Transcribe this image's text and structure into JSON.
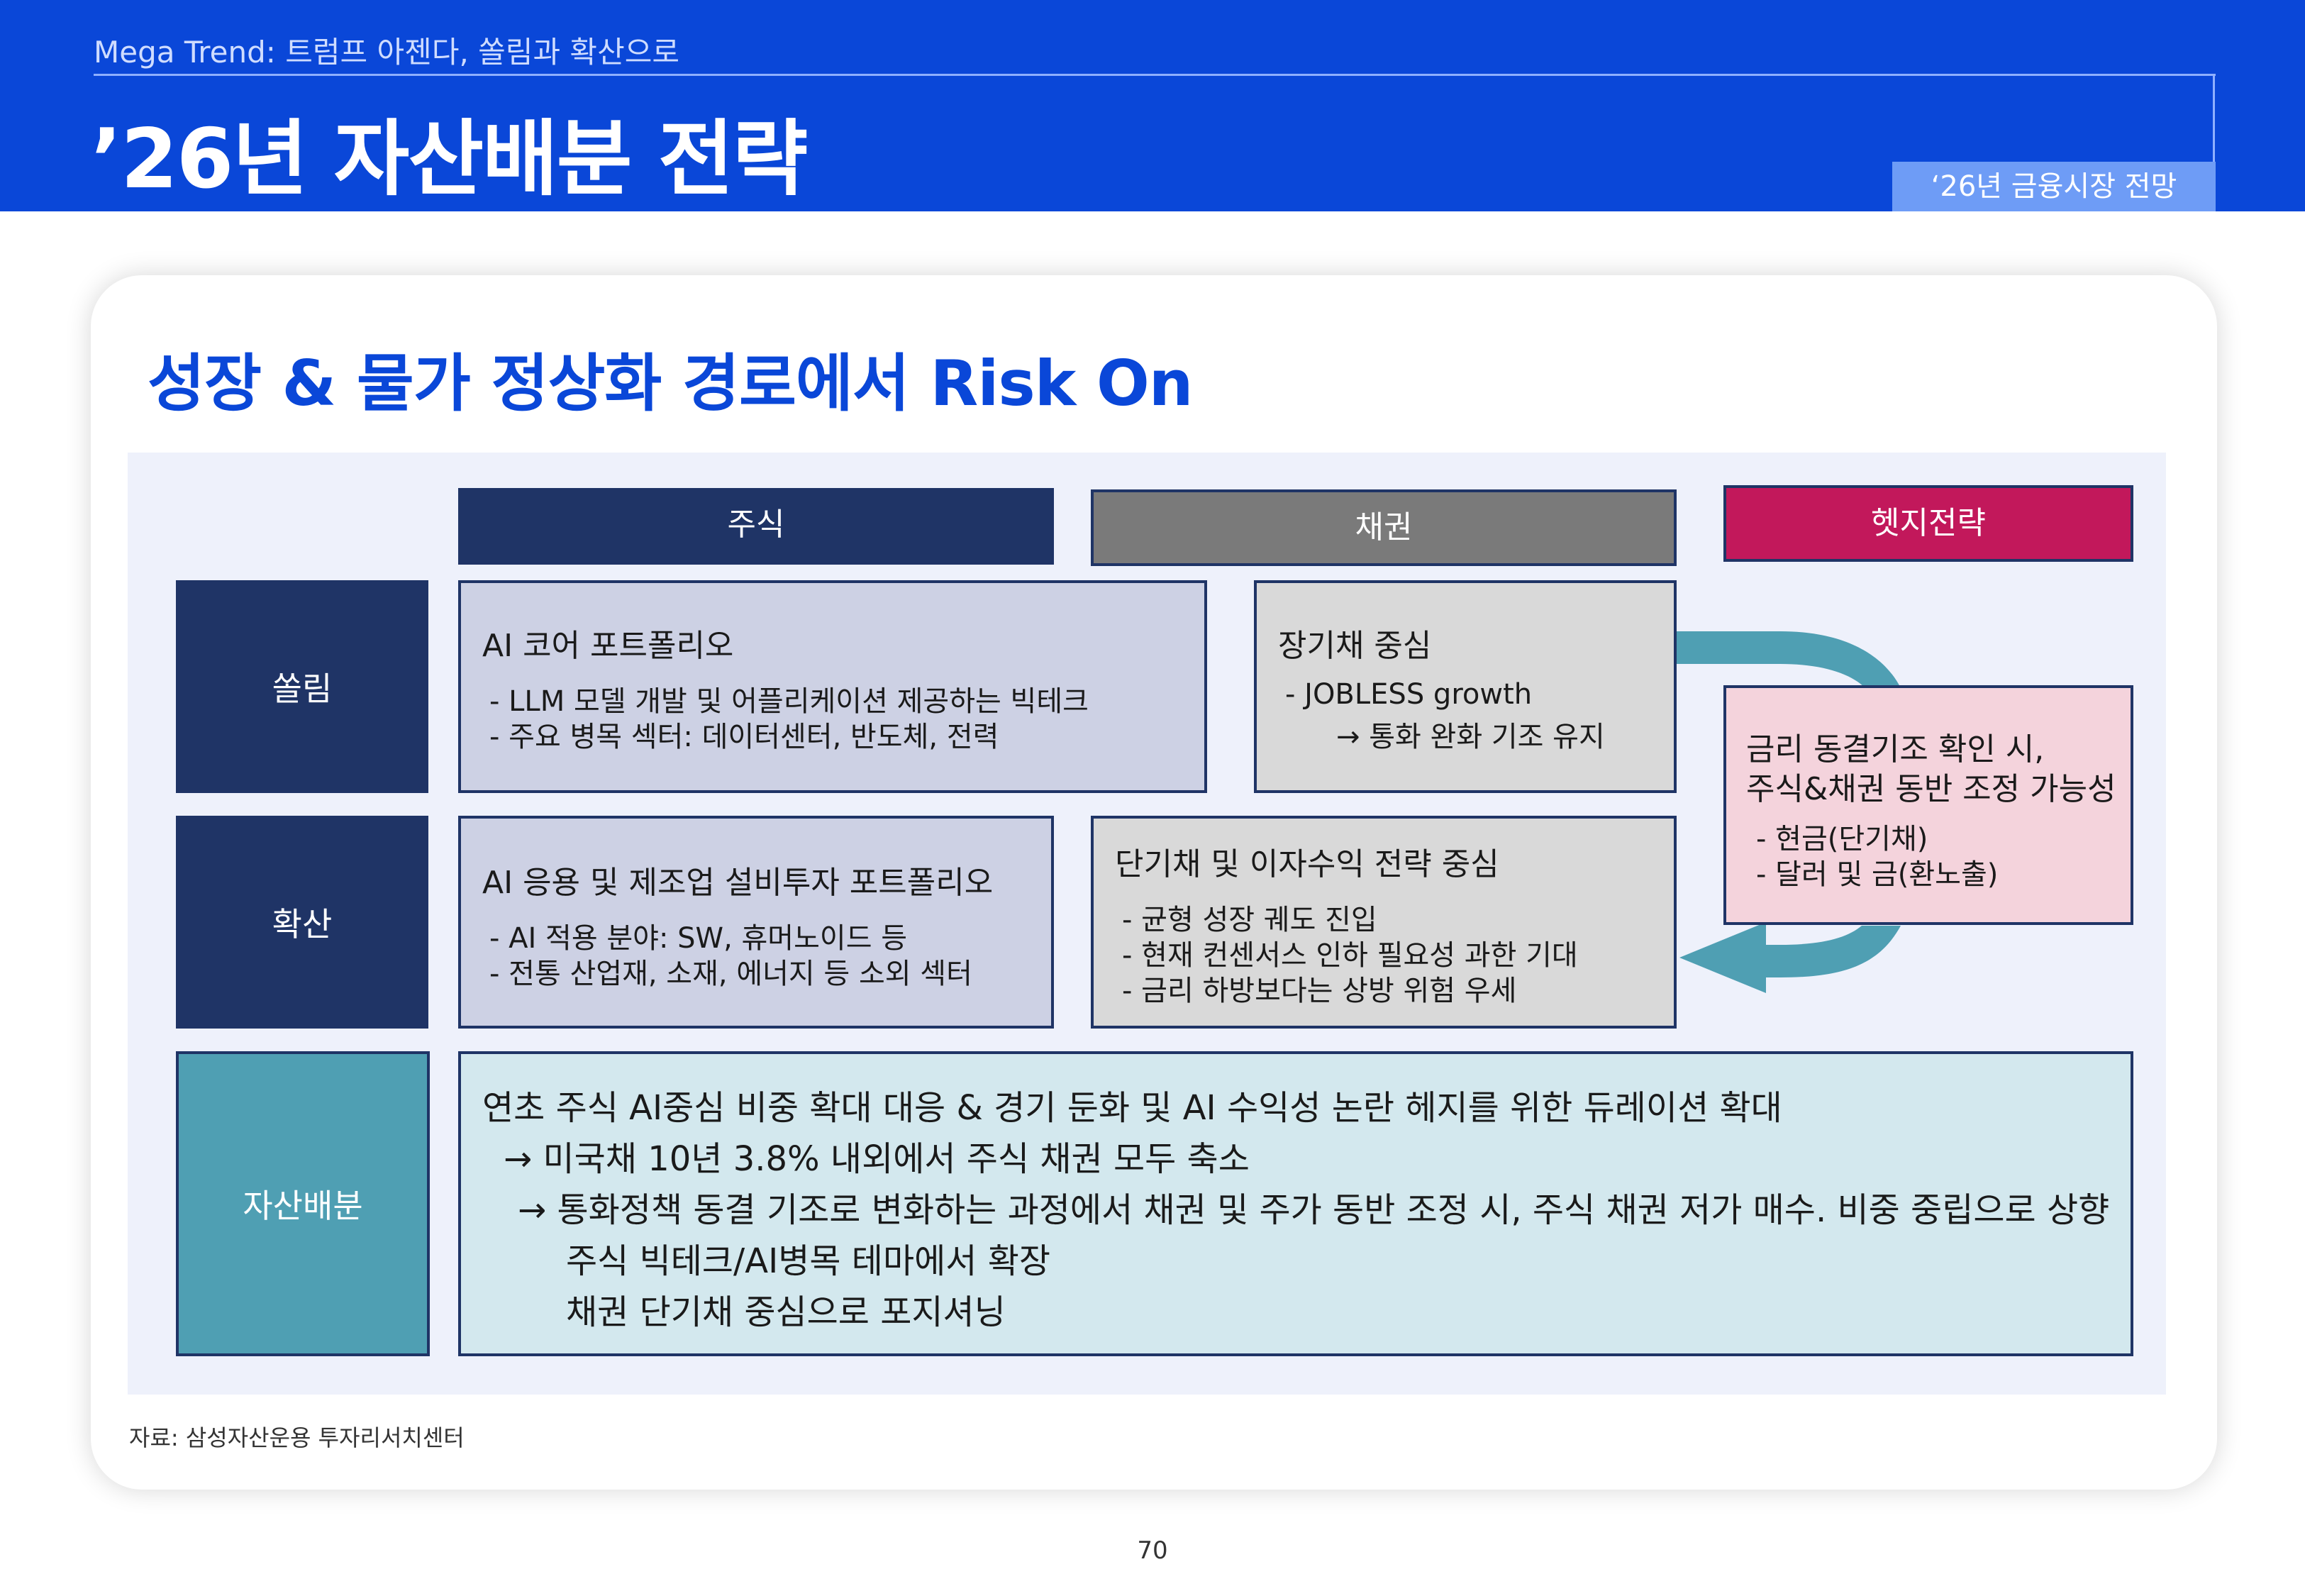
{
  "header": {
    "subtitle": "Mega Trend: 트럼프 아젠다, 쏠림과 확산으로",
    "title": "’26년 자산배분 전략",
    "tag": "‘26년 금융시장 전망"
  },
  "card": {
    "title": "성장 & 물가 정상화 경로에서 Risk On"
  },
  "columns": {
    "stocks": "주식",
    "bonds": "채권",
    "hedge": "헷지전략"
  },
  "rows": {
    "concentration": "쏠림",
    "diffusion": "확산",
    "allocation": "자산배분"
  },
  "cells": {
    "stock_concentration": {
      "title": "AI 코어 포트폴리오",
      "items": [
        "- LLM 모델 개발 및 어플리케이션 제공하는 빅테크",
        "- 주요 병목 섹터: 데이터센터, 반도체, 전력"
      ]
    },
    "bond_concentration": {
      "title": "장기채 중심",
      "items": [
        "- JOBLESS growth",
        "→ 통화 완화 기조 유지"
      ]
    },
    "stock_diffusion": {
      "title": "AI 응용 및 제조업 설비투자 포트폴리오",
      "items": [
        "- AI 적용 분야: SW, 휴머노이드 등",
        "- 전통 산업재, 소재, 에너지 등 소외 섹터"
      ]
    },
    "bond_diffusion": {
      "title": "단기채 및 이자수익 전략 중심",
      "items": [
        "- 균형 성장 궤도 진입",
        "- 현재 컨센서스 인하 필요성 과한 기대",
        "-  금리 하방보다는 상방 위험 우세"
      ]
    },
    "hedge": {
      "title_line1": "금리 동결기조 확인 시,",
      "title_line2": "주식&채권 동반 조정 가능성",
      "items": [
        "- 현금(단기채)",
        "- 달러 및 금(환노출)"
      ]
    }
  },
  "allocation": {
    "lines": [
      "연초 주식 AI중심 비중 확대 대응 & 경기 둔화 및 AI 수익성 논란 헤지를 위한 듀레이션 확대",
      "→ 미국채 10년 3.8% 내외에서 주식 채권 모두 축소",
      "→ 통화정책 동결 기조로 변화하는 과정에서 채권 및 주가 동반 조정 시, 주식 채권 저가 매수. 비중 중립으로 상향",
      "주식 빅테크/AI병목 테마에서 확장",
      "채권 단기채 중심으로 포지셔닝"
    ]
  },
  "footer": {
    "source": "자료: 삼성자산운용 투자리서치센터",
    "page": "70"
  },
  "colors": {
    "brand_blue": "#0a47d8",
    "navy": "#1f3466",
    "gray": "#7a7a7a",
    "magenta": "#c2185b",
    "teal": "#4f9fb3",
    "teal_light": "#d3e8ee",
    "lavender": "#cdd1e4",
    "light_gray": "#d9d9d9",
    "pink": "#f4d3dc"
  },
  "icons": {
    "flow_arrow": "curved-arrow-icon"
  }
}
